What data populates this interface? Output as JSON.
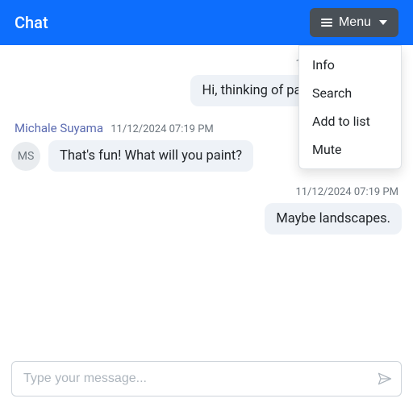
{
  "header": {
    "title": "Chat",
    "menu_label": "Menu"
  },
  "menu": {
    "items": [
      "Info",
      "Search",
      "Add to list",
      "Mute"
    ]
  },
  "messages": [
    {
      "side": "mine",
      "timestamp": "11/12/2024 07:19 PM",
      "text": "Hi, thinking of painting this year."
    },
    {
      "side": "other",
      "sender": "Michale Suyama",
      "initials": "MS",
      "timestamp": "11/12/2024 07:19 PM",
      "text": "That's fun! What will you paint?"
    },
    {
      "side": "mine",
      "timestamp": "11/12/2024 07:19 PM",
      "text": "Maybe landscapes."
    }
  ],
  "composer": {
    "placeholder": "Type your message..."
  }
}
